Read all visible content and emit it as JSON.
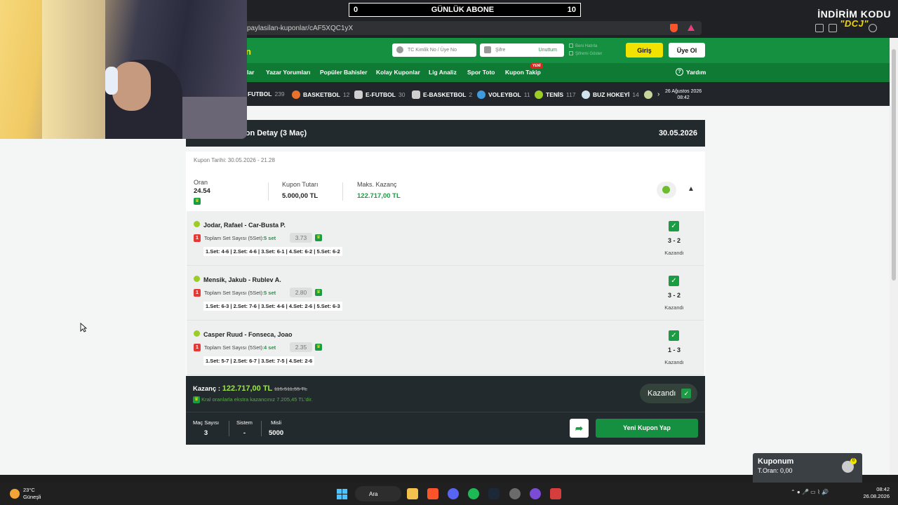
{
  "overlay": {
    "abone_left": "0",
    "abone_title": "GÜNLÜK ABONE",
    "abone_right": "10",
    "indirim_title": "İNDİRİM KODU",
    "indirim_code": "\"DCJ\""
  },
  "browser": {
    "url": "paylasilan-kuponlar/cAF5XQC1yX"
  },
  "header": {
    "logo_fragment": "n",
    "tc_placeholder": "TC Kimlik No / Üye No",
    "password_placeholder": "Şifre",
    "forgot_label": "Unuttum",
    "remember_label": "Beni Hatırla",
    "remember_label2": "Şifremi Göster",
    "login_label": "Giriş",
    "register_label": "Üye Ol"
  },
  "nav": {
    "items": [
      "lar",
      "Yazar Yorumları",
      "Popüler Bahisler",
      "Kolay Kuponlar",
      "Lig Analiz",
      "Spor Toto",
      "Kupon Takip"
    ],
    "new_badge": "YENİ",
    "help_label": "Yardım"
  },
  "sports": {
    "items": [
      {
        "name": "FUTBOL",
        "count": "239",
        "color": "#ffffff"
      },
      {
        "name": "BASKETBOL",
        "count": "12",
        "color": "#e8712b"
      },
      {
        "name": "E-FUTBOL",
        "count": "30",
        "color": "#cfcfcf"
      },
      {
        "name": "E-BASKETBOL",
        "count": "2",
        "color": "#e8712b"
      },
      {
        "name": "VOLEYBOL",
        "count": "11",
        "color": "#3f9be0"
      },
      {
        "name": "TENİS",
        "count": "117",
        "color": "#9ccc26"
      },
      {
        "name": "BUZ HOKEYİ",
        "count": "14",
        "color": "#cfe3ef"
      }
    ],
    "date": "26 Ağustos 2026",
    "time": "08:42"
  },
  "coupon": {
    "header_title": "pon Detay (3 Maç)",
    "header_date": "30.05.2026",
    "date_line": "Kupon Tarihi: 30.05.2026 - 21.28",
    "odds_label": "Oran",
    "odds_value": "24.54",
    "amount_label": "Kupon Tutarı",
    "amount_value": "5.000,00 TL",
    "max_label": "Maks. Kazanç",
    "max_value": "122.717,00 TL",
    "matches": [
      {
        "title": "Jodar, Rafael - Car-Busta P.",
        "bet_label": "Toplam Set Sayısı (5Set):",
        "bet_pick": "5 set",
        "odd": "3.73",
        "sets": "1.Set: 4-6 | 2.Set: 4-6 | 3.Set: 6-1 | 4.Set: 6-2 | 5.Set: 6-2",
        "score": "3 - 2",
        "result": "Kazandı"
      },
      {
        "title": "Mensik, Jakub - Rublev A.",
        "bet_label": "Toplam Set Sayısı (5Set):",
        "bet_pick": "5 set",
        "odd": "2.80",
        "sets": "1.Set: 6-3 | 2.Set: 7-6 | 3.Set: 4-6 | 4.Set: 2-6 | 5.Set: 6-3",
        "score": "3 - 2",
        "result": "Kazandı"
      },
      {
        "title": "Casper Ruud - Fonseca, Joao",
        "bet_label": "Toplam Set Sayısı (5Set):",
        "bet_pick": "4 set",
        "odd": "2.35",
        "sets": "1.Set: 5-7 | 2.Set: 6-7 | 3.Set: 7-5 | 4.Set: 2-6",
        "score": "1 - 3",
        "result": "Kazandı"
      }
    ],
    "win_label": "Kazanç :",
    "win_value": "122.717,00 TL",
    "win_old": "115.511,55 TL",
    "kral_note": "Kral oranlarla ekstra kazancınız 7.205,45 TL'dir.",
    "status_button": "Kazandı",
    "stats": [
      {
        "label": "Maç Sayısı",
        "value": "3"
      },
      {
        "label": "Sistem",
        "value": "-"
      },
      {
        "label": "Misli",
        "value": "5000"
      }
    ],
    "new_coupon_button": "Yeni Kupon Yap"
  },
  "kuponum": {
    "title": "Kuponum",
    "odds": "T.Oran: 0,00",
    "badge": "0"
  },
  "taskbar": {
    "temp": "23°C",
    "weather": "Güneşli",
    "search": "Ara",
    "time": "08:42",
    "date": "26.08.2026"
  },
  "colors": {
    "brand_green": "#149040",
    "accent_yellow": "#f2e200",
    "dark": "#232a2e",
    "win_green": "#9de34b"
  }
}
